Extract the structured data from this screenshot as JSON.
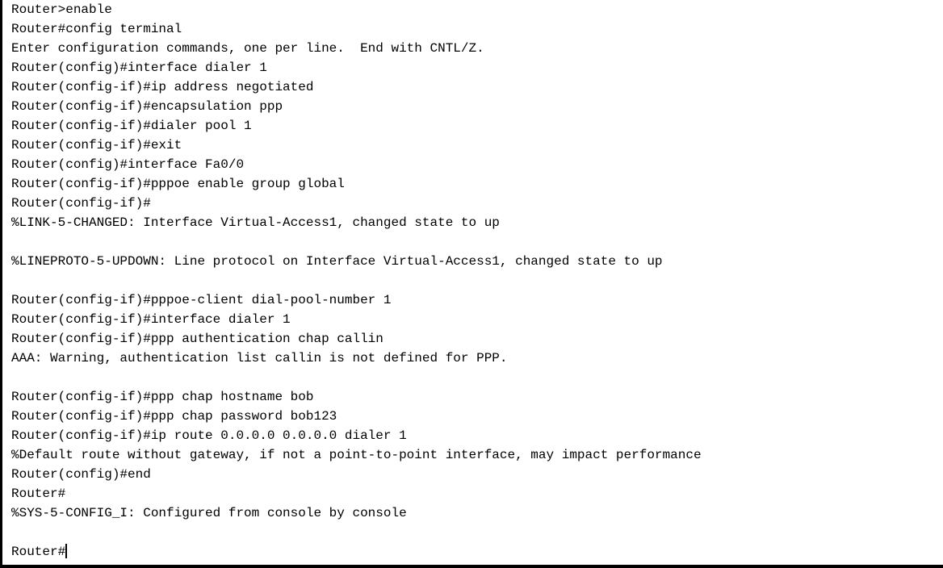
{
  "terminal": {
    "lines": [
      "Router>enable",
      "Router#config terminal",
      "Enter configuration commands, one per line.  End with CNTL/Z.",
      "Router(config)#interface dialer 1",
      "Router(config-if)#ip address negotiated",
      "Router(config-if)#encapsulation ppp",
      "Router(config-if)#dialer pool 1",
      "Router(config-if)#exit",
      "Router(config)#interface Fa0/0",
      "Router(config-if)#pppoe enable group global",
      "Router(config-if)#",
      "%LINK-5-CHANGED: Interface Virtual-Access1, changed state to up",
      "",
      "%LINEPROTO-5-UPDOWN: Line protocol on Interface Virtual-Access1, changed state to up",
      "",
      "Router(config-if)#pppoe-client dial-pool-number 1",
      "Router(config-if)#interface dialer 1",
      "Router(config-if)#ppp authentication chap callin",
      "AAA: Warning, authentication list callin is not defined for PPP.",
      "",
      "Router(config-if)#ppp chap hostname bob",
      "Router(config-if)#ppp chap password bob123",
      "Router(config-if)#ip route 0.0.0.0 0.0.0.0 dialer 1",
      "%Default route without gateway, if not a point-to-point interface, may impact performance",
      "Router(config)#end",
      "Router#",
      "%SYS-5-CONFIG_I: Configured from console by console",
      ""
    ],
    "prompt": "Router#"
  }
}
